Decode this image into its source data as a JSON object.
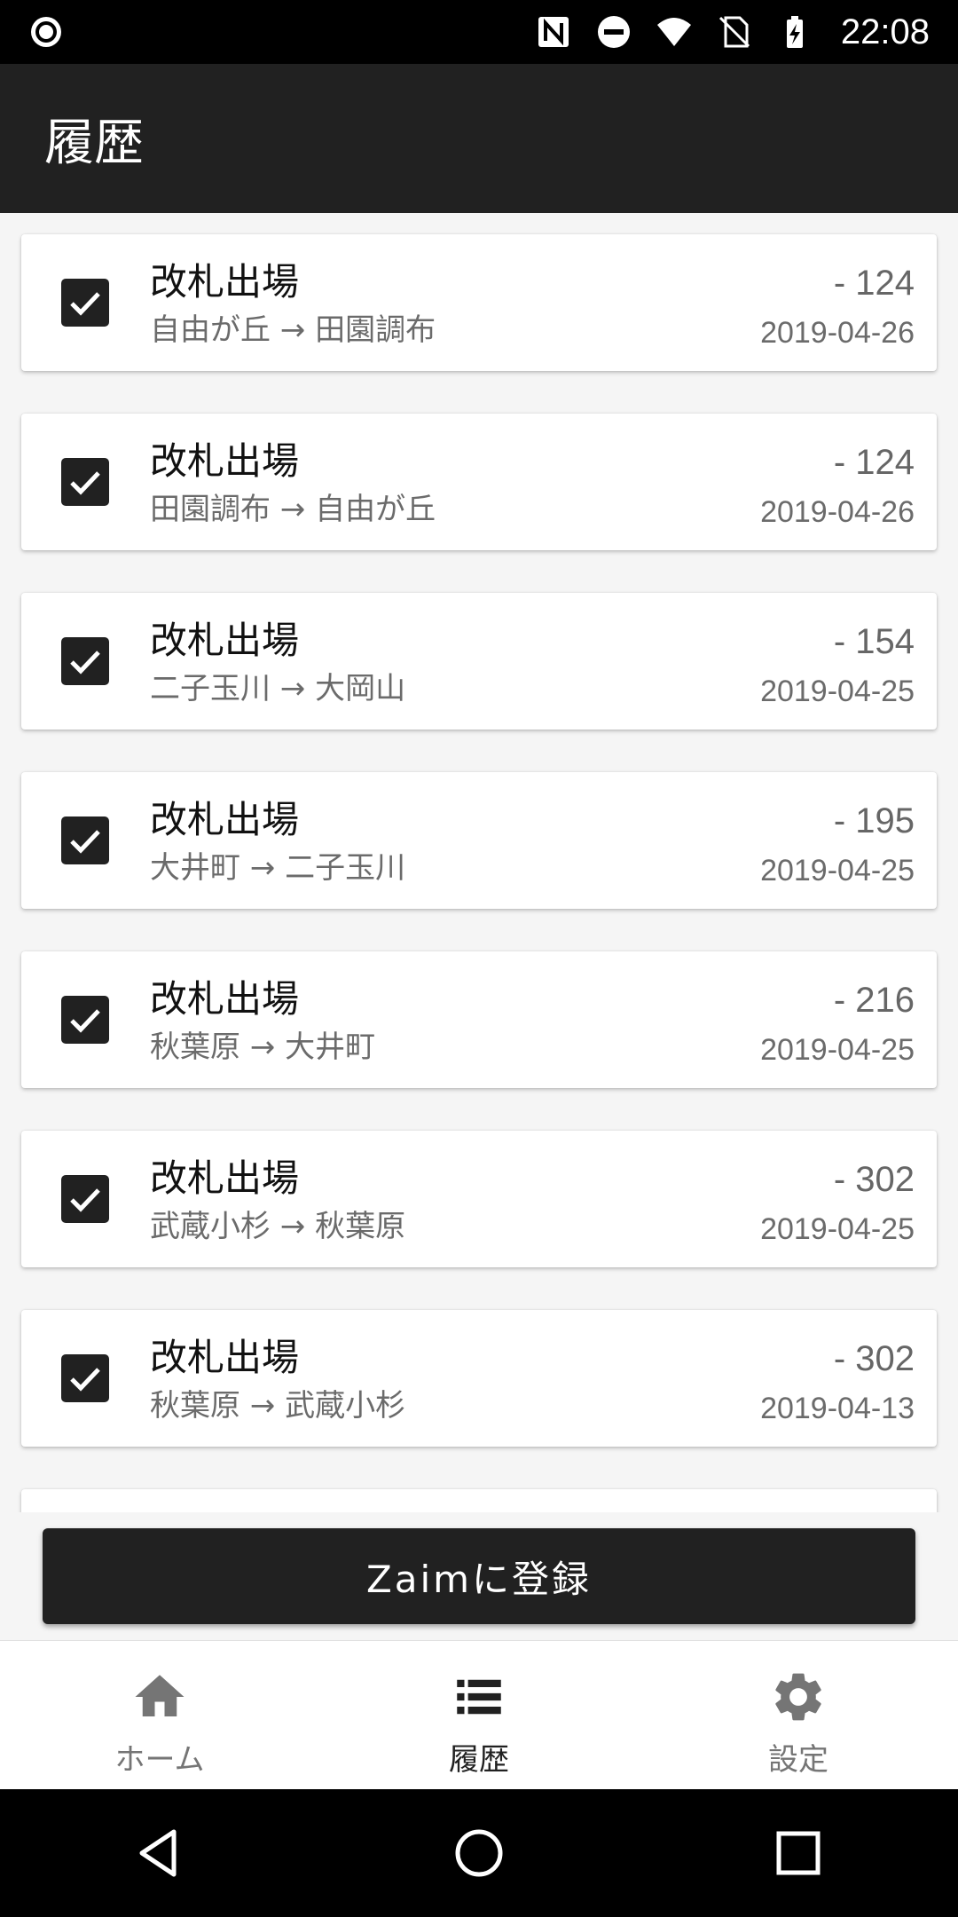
{
  "status_bar": {
    "time": "22:08",
    "icons": [
      "record-icon",
      "nfc-icon",
      "do-not-disturb-icon",
      "wifi-icon",
      "no-sim-icon",
      "battery-charging-icon"
    ]
  },
  "app_bar": {
    "title": "履歴"
  },
  "history": {
    "items": [
      {
        "title": "改札出場",
        "route": "自由が丘 → 田園調布",
        "amount": "- 124",
        "date": "2019-04-26",
        "checked": true
      },
      {
        "title": "改札出場",
        "route": "田園調布 → 自由が丘",
        "amount": "- 124",
        "date": "2019-04-26",
        "checked": true
      },
      {
        "title": "改札出場",
        "route": "二子玉川 → 大岡山",
        "amount": "- 154",
        "date": "2019-04-25",
        "checked": true
      },
      {
        "title": "改札出場",
        "route": "大井町 → 二子玉川",
        "amount": "- 195",
        "date": "2019-04-25",
        "checked": true
      },
      {
        "title": "改札出場",
        "route": "秋葉原 → 大井町",
        "amount": "- 216",
        "date": "2019-04-25",
        "checked": true
      },
      {
        "title": "改札出場",
        "route": "武蔵小杉 → 秋葉原",
        "amount": "- 302",
        "date": "2019-04-25",
        "checked": true
      },
      {
        "title": "改札出場",
        "route": "秋葉原 → 武蔵小杉",
        "amount": "- 302",
        "date": "2019-04-13",
        "checked": true
      }
    ]
  },
  "register_button": {
    "label": "Zaimに登録"
  },
  "bottom_nav": {
    "items": [
      {
        "label": "ホーム",
        "icon": "home-icon",
        "active": false
      },
      {
        "label": "履歴",
        "icon": "list-icon",
        "active": true
      },
      {
        "label": "設定",
        "icon": "gear-icon",
        "active": false
      }
    ]
  },
  "system_nav": {
    "icons": [
      "back-icon",
      "home-circle-icon",
      "recents-icon"
    ]
  },
  "colors": {
    "app_bar": "#212121",
    "accent": "#212121",
    "background": "#f5f5f5",
    "inactive": "#757575"
  }
}
